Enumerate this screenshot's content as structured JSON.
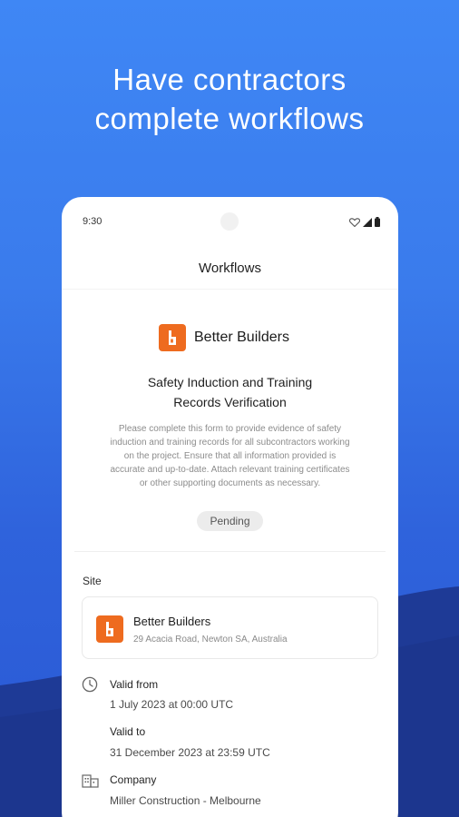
{
  "headline": {
    "line1": "Have contractors",
    "line2": "complete workflows"
  },
  "status_bar": {
    "time": "9:30"
  },
  "app": {
    "title": "Workflows"
  },
  "organization": {
    "name": "Better Builders"
  },
  "form": {
    "title_line1": "Safety Induction and Training",
    "title_line2": "Records Verification",
    "description_lines": [
      "Please complete this form to provide evidence of safety",
      "induction and training records for all subcontractors working",
      "on the project. Ensure that all information provided is",
      "accurate and up-to-date. Attach relevant training certificates",
      "or other supporting documents as necessary."
    ],
    "status": "Pending"
  },
  "site": {
    "label": "Site",
    "name": "Better Builders",
    "address": "29 Acacia Road, Newton SA, Australia"
  },
  "validity": {
    "from_label": "Valid from",
    "from_value": "1 July 2023 at 00:00 UTC",
    "to_label": "Valid to",
    "to_value": "31 December 2023 at 23:59 UTC"
  },
  "company": {
    "label": "Company",
    "value": "Miller Construction - Melbourne"
  },
  "icons": {
    "status": [
      "heart-icon",
      "signal-icon",
      "battery-icon"
    ],
    "brand_logo": "building-logo-icon",
    "clock": "clock-icon",
    "company": "buildings-icon"
  },
  "colors": {
    "background": "#3a7bec",
    "wave": "#1f3f9e",
    "brand": "#ee6b1f",
    "card": "#ffffff",
    "pending_badge": "#ececec"
  }
}
